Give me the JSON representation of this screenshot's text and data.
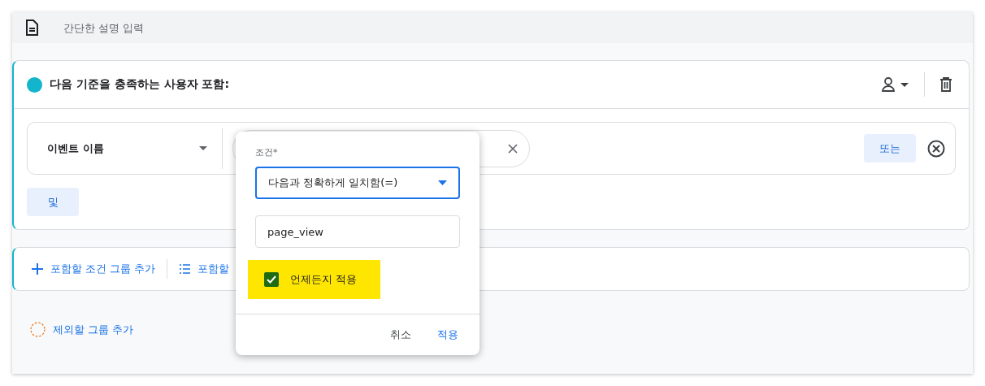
{
  "description": {
    "placeholder": "간단한 설명 입력"
  },
  "include_group": {
    "title": "다음 기준을 충족하는 사용자 포함:",
    "color": "#12b5cb",
    "condition": {
      "dimension": "이벤트 이름",
      "or_button": "또는"
    },
    "and_button": "및"
  },
  "group_actions": {
    "add_include_group": "포함할 조건 그룹 추가",
    "add_sequence": "포함할"
  },
  "exclude": {
    "add_exclude_group": "제외할 그룹 추가"
  },
  "popup": {
    "condition_label": "조건*",
    "condition_value": "다음과 정확하게 일치함(=)",
    "value": "page_view",
    "always_apply": {
      "label": "언제든지 적용",
      "checked": true
    },
    "buttons": {
      "cancel": "취소",
      "apply": "적용"
    }
  }
}
